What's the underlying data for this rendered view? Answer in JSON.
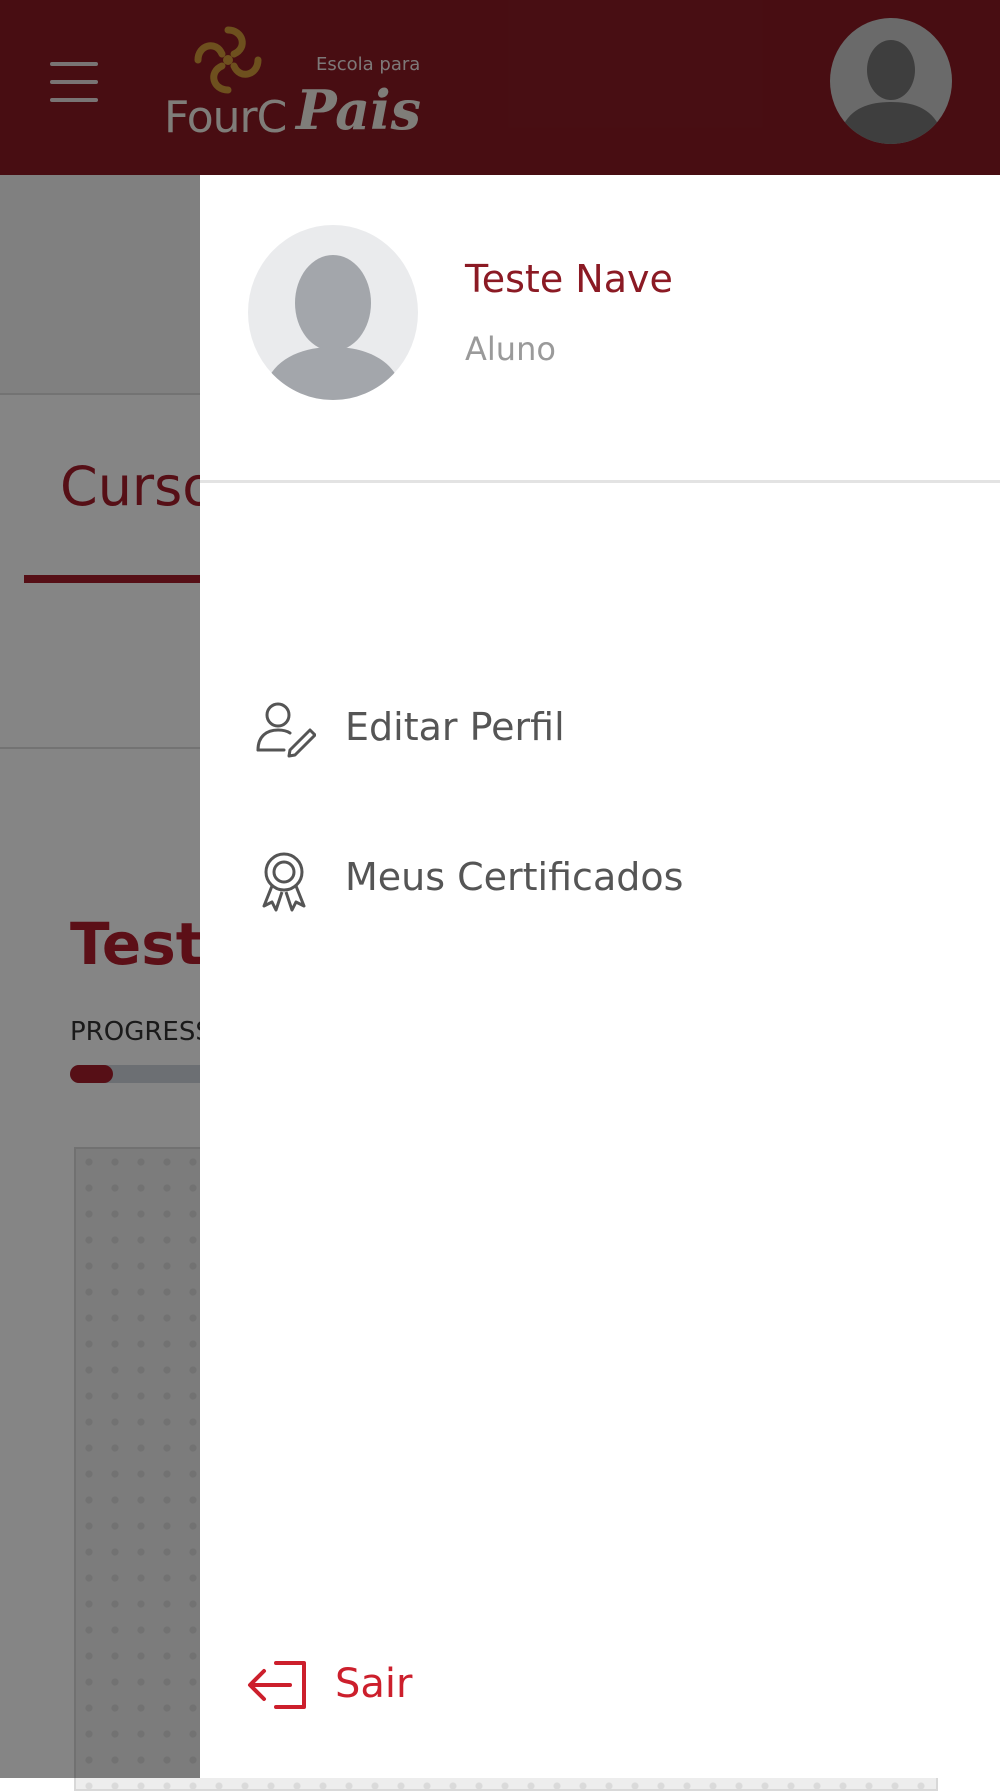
{
  "colors": {
    "brand": "#8b1a24",
    "accent": "#a51d2b",
    "logout": "#cc1f2c",
    "menu_text": "#555555",
    "muted_text": "#9a9a9a"
  },
  "header": {
    "menu_icon": "hamburger-icon",
    "logo": {
      "brand": "FourC",
      "tagline_small": "Escola para",
      "tagline_large": "Pais"
    },
    "avatar_icon": "user-avatar-icon"
  },
  "background_page": {
    "tab_label": "Cursos",
    "course_title": "Teste",
    "progress_label": "PROGRESSO",
    "progress_value": 0.05
  },
  "drawer": {
    "user": {
      "name": "Teste Nave",
      "role": "Aluno",
      "avatar_icon": "user-avatar-icon"
    },
    "menu": [
      {
        "label": "Editar Perfil",
        "icon": "user-edit-icon"
      },
      {
        "label": "Meus Certificados",
        "icon": "certificate-icon"
      }
    ],
    "logout": {
      "label": "Sair",
      "icon": "logout-icon"
    }
  }
}
